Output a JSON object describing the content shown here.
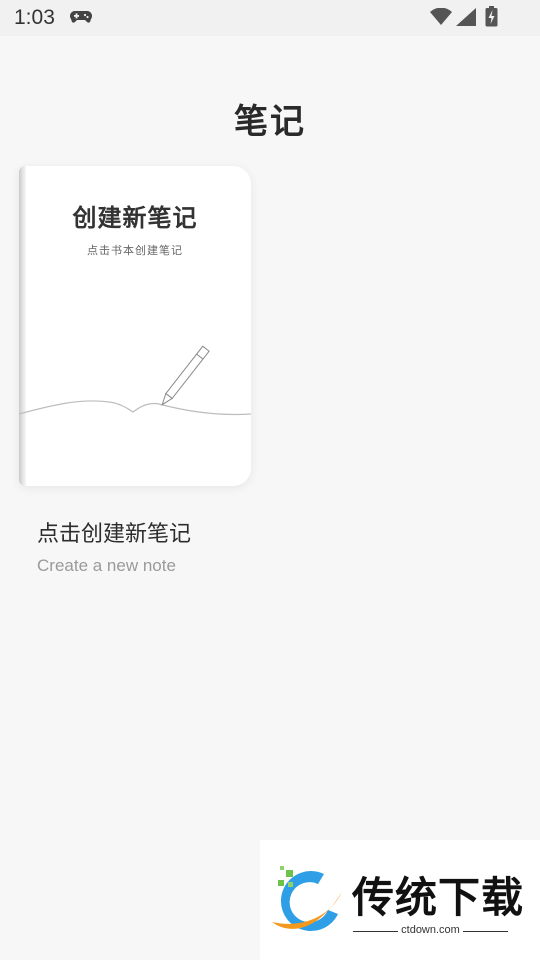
{
  "status_bar": {
    "time": "1:03",
    "icons": [
      "gamepad-icon",
      "wifi-icon",
      "signal-icon",
      "battery-icon"
    ]
  },
  "header": {
    "title": "笔记"
  },
  "notebook_card": {
    "cover_title": "创建新笔记",
    "cover_subtitle": "点击书本创建笔记",
    "label": "点击创建新笔记",
    "sublabel": "Create a new note"
  },
  "watermark": {
    "name": "传统下载",
    "url": "ctdown.com"
  },
  "colors": {
    "background": "#f7f7f8",
    "status_bar": "#f1f1f2",
    "title_text": "#2a2a2a",
    "secondary_text": "#9a9a9a"
  }
}
